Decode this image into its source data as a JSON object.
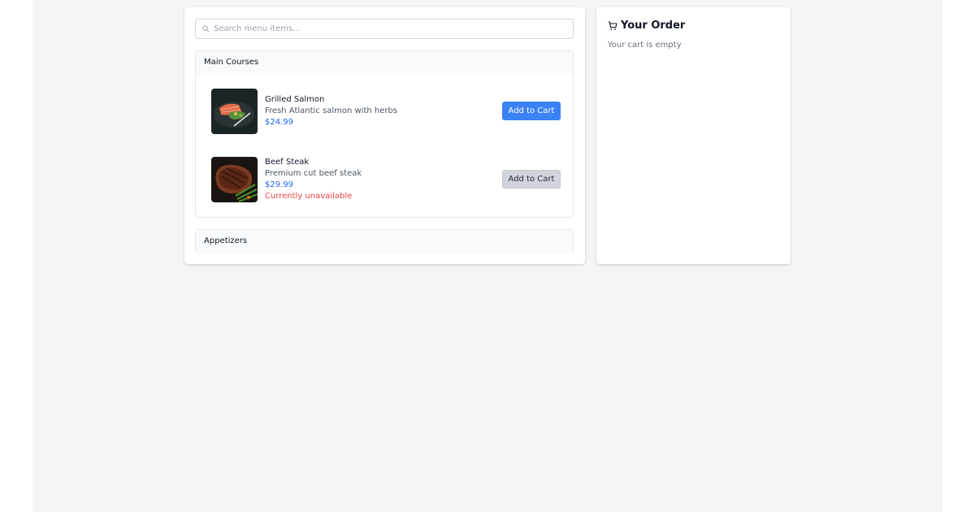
{
  "search": {
    "placeholder": "Search menu items..."
  },
  "sections": [
    {
      "title": "Main Courses",
      "items": [
        {
          "name": "Grilled Salmon",
          "description": "Fresh Atlantic salmon with herbs",
          "price": "$24.99",
          "button": "Add to Cart",
          "status": ""
        },
        {
          "name": "Beef Steak",
          "description": "Premium cut beef steak",
          "price": "$29.99",
          "button": "Add to Cart",
          "status": "Currently unavailable"
        }
      ]
    },
    {
      "title": "Appetizers",
      "items": []
    }
  ],
  "order": {
    "title": "Your Order",
    "empty_text": "Your cart is empty"
  },
  "icons": {
    "search": "search-icon",
    "cart": "shopping-cart-icon"
  },
  "colors": {
    "accent": "#3b82f6",
    "price": "#2563eb",
    "error": "#ef4444",
    "background": "#f3f4f6"
  }
}
